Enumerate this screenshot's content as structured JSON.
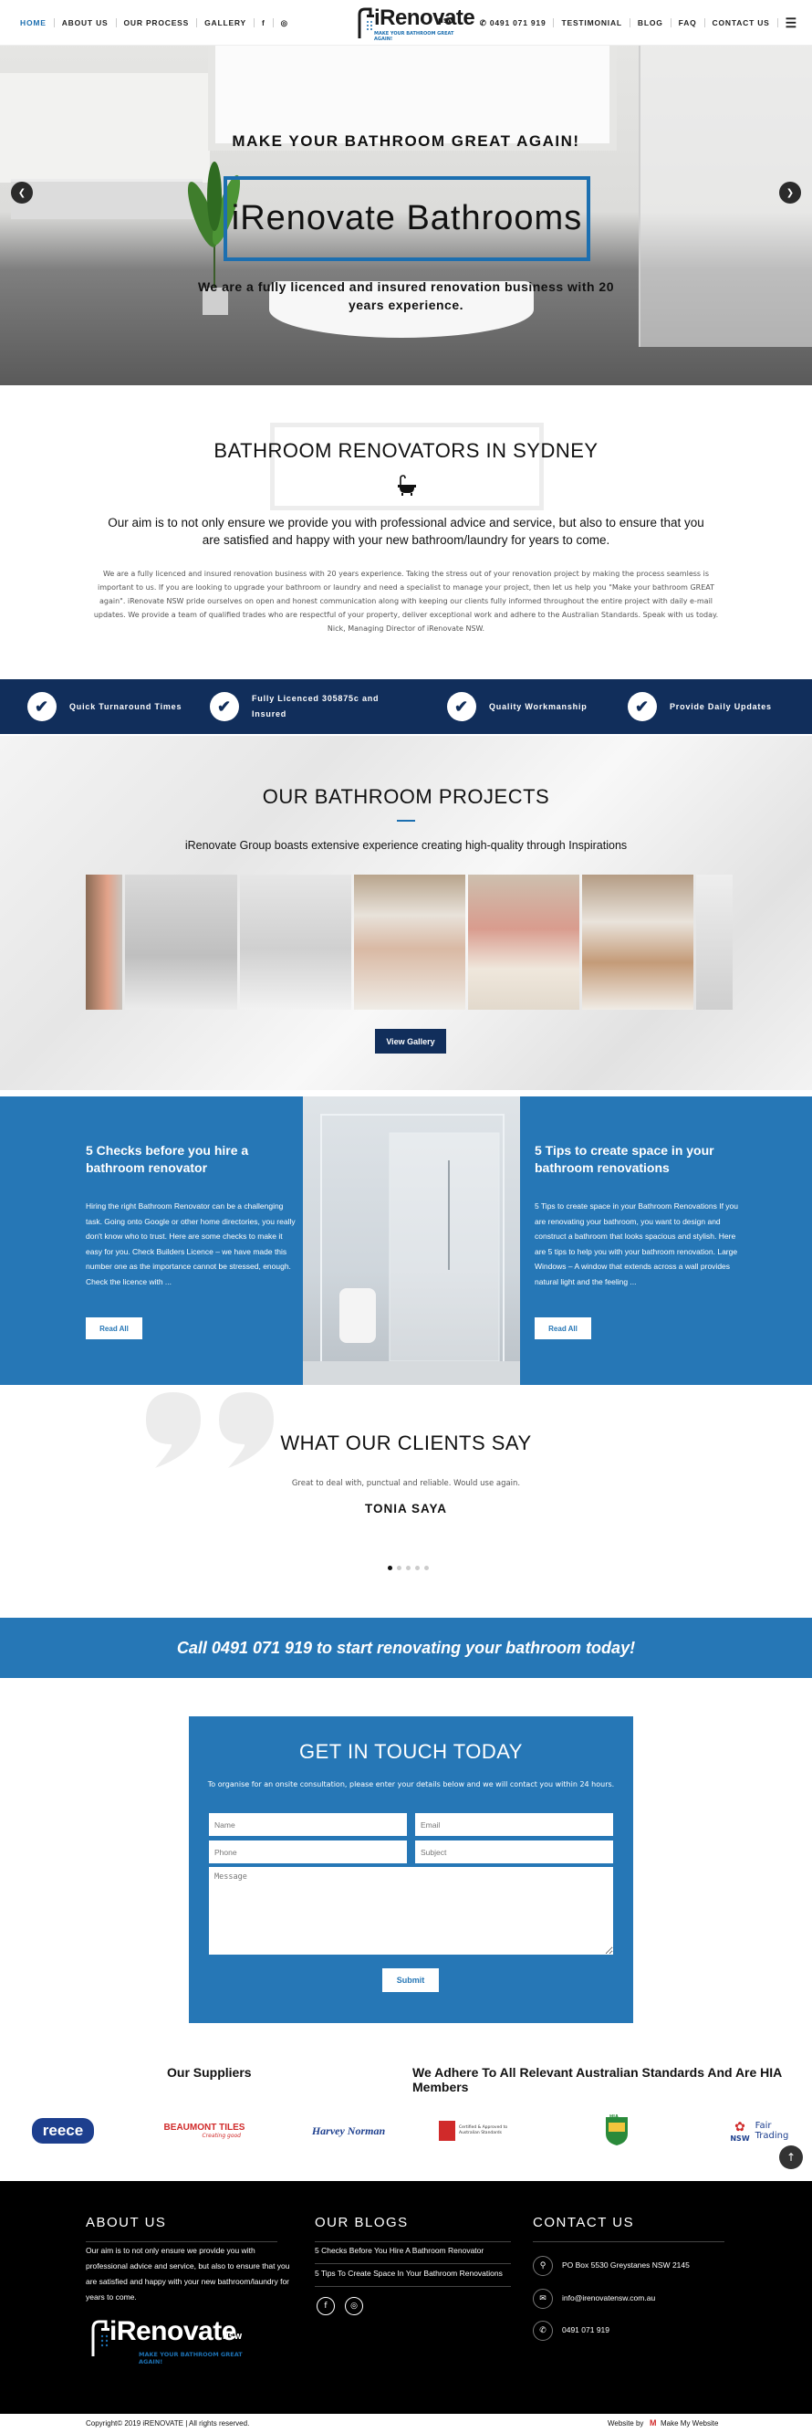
{
  "nav": {
    "left": [
      "HOME",
      "ABOUT US",
      "OUR PROCESS",
      "GALLERY"
    ],
    "right": [
      "0491 071 919",
      "TESTIMONIAL",
      "BLOG",
      "FAQ",
      "CONTACT US"
    ],
    "social_left": [
      "f",
      "◎"
    ],
    "logo_text": "iRenovate",
    "logo_suffix": "NSW",
    "logo_tagline": "MAKE YOUR BATHROOM GREAT AGAIN!"
  },
  "hero": {
    "subtitle": "MAKE YOUR BATHROOM GREAT AGAIN!",
    "title": "iRenovate Bathrooms",
    "description": "We are a fully licenced and insured renovation business with 20 years experience.",
    "prev": "❮",
    "next": "❯"
  },
  "intro": {
    "title": "BATHROOM RENOVATORS IN SYDNEY",
    "lead": "Our aim is to not only ensure we provide you with professional advice and service, but also to ensure that you are satisfied and happy with your new bathroom/laundry for years to come.",
    "body": "We are a fully licenced and insured renovation business with 20 years experience. Taking the stress out of your renovation project by making the process seamless is important to us. If you are looking to upgrade your bathroom or laundry and need a specialist to manage your project, then let us help you \"Make your bathroom GREAT again\". iRenovate NSW pride ourselves on open and honest communication along with keeping our clients fully informed throughout the entire project with daily e-mail updates. We provide a team of qualified trades who are respectful of your property, deliver exceptional work and adhere to the Australian Standards. Speak with us today. Nick, Managing Director of iRenovate NSW."
  },
  "features": [
    {
      "label": "Quick Turnaround Times"
    },
    {
      "label": "Fully Licenced 305875c and Insured"
    },
    {
      "label": "Quality Workmanship"
    },
    {
      "label": "Provide Daily Updates"
    }
  ],
  "projects": {
    "title": "OUR BATHROOM PROJECTS",
    "subtitle": "iRenovate Group boasts extensive experience creating high-quality through Inspirations",
    "button": "View Gallery"
  },
  "blogs": [
    {
      "title": "5 Checks before you hire a bathroom renovator",
      "excerpt": "Hiring the right Bathroom Renovator can be a challenging task. Going onto Google or other home directories, you really don't know who to trust. Here are some checks to make it easy for you. Check Builders Licence – we have made this number one as the importance cannot be stressed, enough. Check the licence with ...",
      "button": "Read All"
    },
    {
      "title": "5 Tips to create space in your bathroom renovations",
      "excerpt": "5 Tips to create space in your Bathroom Renovations If you are renovating your bathroom, you want to design and construct a bathroom that looks spacious and stylish. Here are 5 tips to help you with your bathroom renovation. Large Windows – A window that extends across a wall provides natural light and the feeling ...",
      "button": "Read All"
    }
  ],
  "testimonials": {
    "title": "WHAT OUR CLIENTS SAY",
    "quote": "Great to deal with, punctual and reliable. Would use again.",
    "name": "TONIA SAYA",
    "dots": 5,
    "active_dot": 1
  },
  "cta": {
    "text": "Call 0491 071 919 to start renovating your bathroom today!"
  },
  "contact_form": {
    "title": "GET IN TOUCH TODAY",
    "subtitle": "To organise for an onsite consultation, please enter your details below and we will contact you within 24 hours.",
    "name_placeholder": "Name",
    "email_placeholder": "Email",
    "phone_placeholder": "Phone",
    "subject_placeholder": "Subject",
    "message_placeholder": "Message",
    "submit": "Submit"
  },
  "suppliers": {
    "title": "Our Suppliers",
    "standards_title": "We Adhere To All Relevant Australian Standards And Are HIA Members",
    "brands": [
      {
        "name": "reece",
        "color": "#1d3f8e"
      },
      {
        "name": "BEAUMONT TILES",
        "sub": "Creating good",
        "color": "#d02a2a"
      },
      {
        "name": "Harvey Norman",
        "color": "#1d3f8e"
      },
      {
        "name": "Certified & Approved to Australian Standards",
        "color": "#d02a2a"
      },
      {
        "name": "HIA",
        "color": "#2a8a3a"
      },
      {
        "name": "NSW",
        "sub": "Fair Trading",
        "color": "#1d3f8e"
      }
    ]
  },
  "footer": {
    "about_title": "ABOUT US",
    "about_text": "Our aim is to not only ensure we provide you with professional advice and service, but also to ensure that you are satisfied and happy with your new bathroom/laundry for years to come.",
    "blogs_title": "OUR BLOGS",
    "blog_links": [
      "5 Checks Before You Hire A Bathroom Renovator",
      "5 Tips To Create Space In Your Bathroom Renovations"
    ],
    "contact_title": "CONTACT US",
    "address": "PO Box 5530 Greystanes NSW 2145",
    "email": "info@irenovatensw.com.au",
    "phone": "0491 071 919",
    "logo_text": "iRenovate",
    "logo_suffix": "NSW",
    "logo_tagline": "MAKE YOUR BATHROOM GREAT AGAIN!",
    "back_to_top": "↑"
  },
  "bottom": {
    "copyright": "Copyright© 2019 iRENOVATE | All rights reserved.",
    "credit_prefix": "Website by",
    "credit_name": "Make My Website"
  },
  "colors": {
    "brand_blue": "#2677b6",
    "navy": "#112e5b",
    "accent": "#1c6fb0"
  }
}
